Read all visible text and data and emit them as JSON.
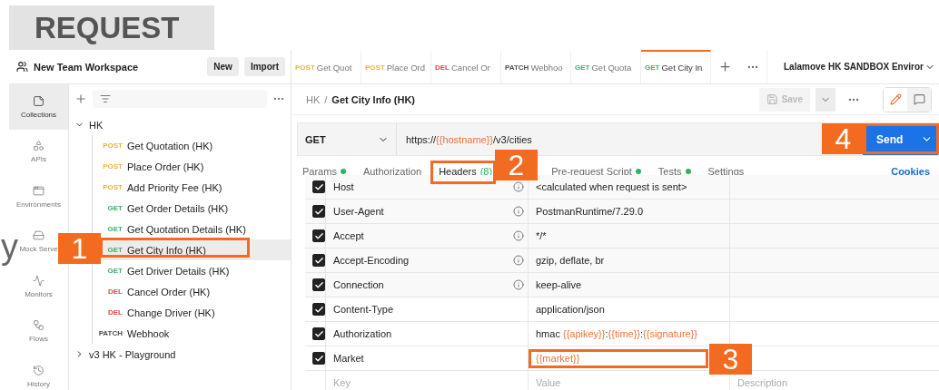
{
  "banner": {
    "title": "REQUEST"
  },
  "fragment_text": "y",
  "workspace": {
    "name": "New Team Workspace",
    "buttons": [
      "New",
      "Import"
    ]
  },
  "rail": [
    {
      "label": "Collections",
      "selected": true
    },
    {
      "label": "APIs",
      "selected": false
    },
    {
      "label": "Environments",
      "selected": false
    },
    {
      "label": "Mock Serve",
      "selected": false
    },
    {
      "label": "Monitors",
      "selected": false
    },
    {
      "label": "Flows",
      "selected": false
    },
    {
      "label": "History",
      "selected": false
    }
  ],
  "tree": [
    {
      "name": "HK",
      "expanded": true,
      "children": [
        {
          "method": "POST",
          "color": "#e8b53c",
          "name": "Get Quotation (HK)",
          "selected": false
        },
        {
          "method": "POST",
          "color": "#e8b53c",
          "name": "Place Order (HK)",
          "selected": false
        },
        {
          "method": "POST",
          "color": "#e8b53c",
          "name": "Add Priority Fee (HK)",
          "selected": false
        },
        {
          "method": "GET",
          "color": "#3dae6e",
          "name": "Get Order Details (HK)",
          "selected": false
        },
        {
          "method": "GET",
          "color": "#3dae6e",
          "name": "Get Quotation Details (HK)",
          "selected": false
        },
        {
          "method": "GET",
          "color": "#3dae6e",
          "name": "Get City Info (HK)",
          "selected": true
        },
        {
          "method": "GET",
          "color": "#3dae6e",
          "name": "Get Driver Details (HK)",
          "selected": false
        },
        {
          "method": "DEL",
          "color": "#e0473f",
          "name": "Cancel Order (HK)",
          "selected": false
        },
        {
          "method": "DEL",
          "color": "#e0473f",
          "name": "Change Driver (HK)",
          "selected": false
        },
        {
          "method": "PATCH",
          "color": "#505050",
          "name": "Webhook",
          "selected": false
        }
      ]
    },
    {
      "name": "v3 HK - Playground",
      "expanded": false
    }
  ],
  "tabs": [
    {
      "method": "POST",
      "color": "#e8b53c",
      "name": "Get Quot",
      "selected": false
    },
    {
      "method": "POST",
      "color": "#e8b53c",
      "name": "Place Ord",
      "selected": false
    },
    {
      "method": "DEL",
      "color": "#e0473f",
      "name": "Cancel Or",
      "selected": false
    },
    {
      "method": "PATCH",
      "color": "#505050",
      "name": "Webhoo",
      "selected": false
    },
    {
      "method": "GET",
      "color": "#3dae6e",
      "name": "Get Quota",
      "selected": false
    },
    {
      "method": "GET",
      "color": "#3dae6e",
      "name": "Get City In",
      "selected": true
    }
  ],
  "environment": "Lalamove HK SANDBOX Enviror",
  "breadcrumb": {
    "parent": "HK",
    "separator": "/",
    "current": "Get City Info (HK)"
  },
  "save": {
    "label": "Save",
    "disabled": true
  },
  "request": {
    "method": "GET",
    "url": [
      {
        "kind": "plain",
        "text": "https://"
      },
      {
        "kind": "variable",
        "text": "{{hostname}}"
      },
      {
        "kind": "plain",
        "text": "/v3/cities"
      }
    ],
    "send": "Send"
  },
  "request_tabs": [
    {
      "label": "Params",
      "dot": true,
      "selected": false
    },
    {
      "label": "Authorization",
      "dot": false,
      "selected": false
    },
    {
      "label": "Headers",
      "count": "(8)",
      "dot": false,
      "selected": true
    },
    {
      "label": "Pre-request Script",
      "dot": true,
      "selected": false
    },
    {
      "label": "Tests",
      "dot": true,
      "selected": false
    },
    {
      "label": "Settings",
      "dot": false,
      "selected": false
    }
  ],
  "cookies": "Cookies",
  "headers": [
    {
      "checked": true,
      "key": "Host",
      "info": true,
      "value": [
        {
          "kind": "plain",
          "text": "<calculated when request is sent>"
        }
      ]
    },
    {
      "checked": true,
      "key": "User-Agent",
      "info": true,
      "value": [
        {
          "kind": "plain",
          "text": "PostmanRuntime/7.29.0"
        }
      ]
    },
    {
      "checked": true,
      "key": "Accept",
      "info": true,
      "value": [
        {
          "kind": "plain",
          "text": "*/*"
        }
      ]
    },
    {
      "checked": true,
      "key": "Accept-Encoding",
      "info": true,
      "value": [
        {
          "kind": "plain",
          "text": "gzip, deflate, br"
        }
      ]
    },
    {
      "checked": true,
      "key": "Connection",
      "info": true,
      "value": [
        {
          "kind": "plain",
          "text": "keep-alive"
        }
      ]
    },
    {
      "checked": true,
      "key": "Content-Type",
      "info": false,
      "value": [
        {
          "kind": "plain",
          "text": "application/json"
        }
      ]
    },
    {
      "checked": true,
      "key": "Authorization",
      "info": false,
      "value": [
        {
          "kind": "plain",
          "text": "hmac "
        },
        {
          "kind": "variable",
          "text": "{{apikey}}"
        },
        {
          "kind": "plain",
          "text": ":"
        },
        {
          "kind": "variable",
          "text": "{{time}}"
        },
        {
          "kind": "plain",
          "text": ":"
        },
        {
          "kind": "variable",
          "text": "{{signature}}"
        }
      ]
    },
    {
      "checked": true,
      "key": "Market",
      "info": false,
      "value": [
        {
          "kind": "variable",
          "text": "{{market}}"
        }
      ]
    }
  ],
  "new_header": {
    "key": "Key",
    "value": "Value",
    "description": "Description"
  },
  "annotations": [
    "1",
    "2",
    "3",
    "4"
  ]
}
